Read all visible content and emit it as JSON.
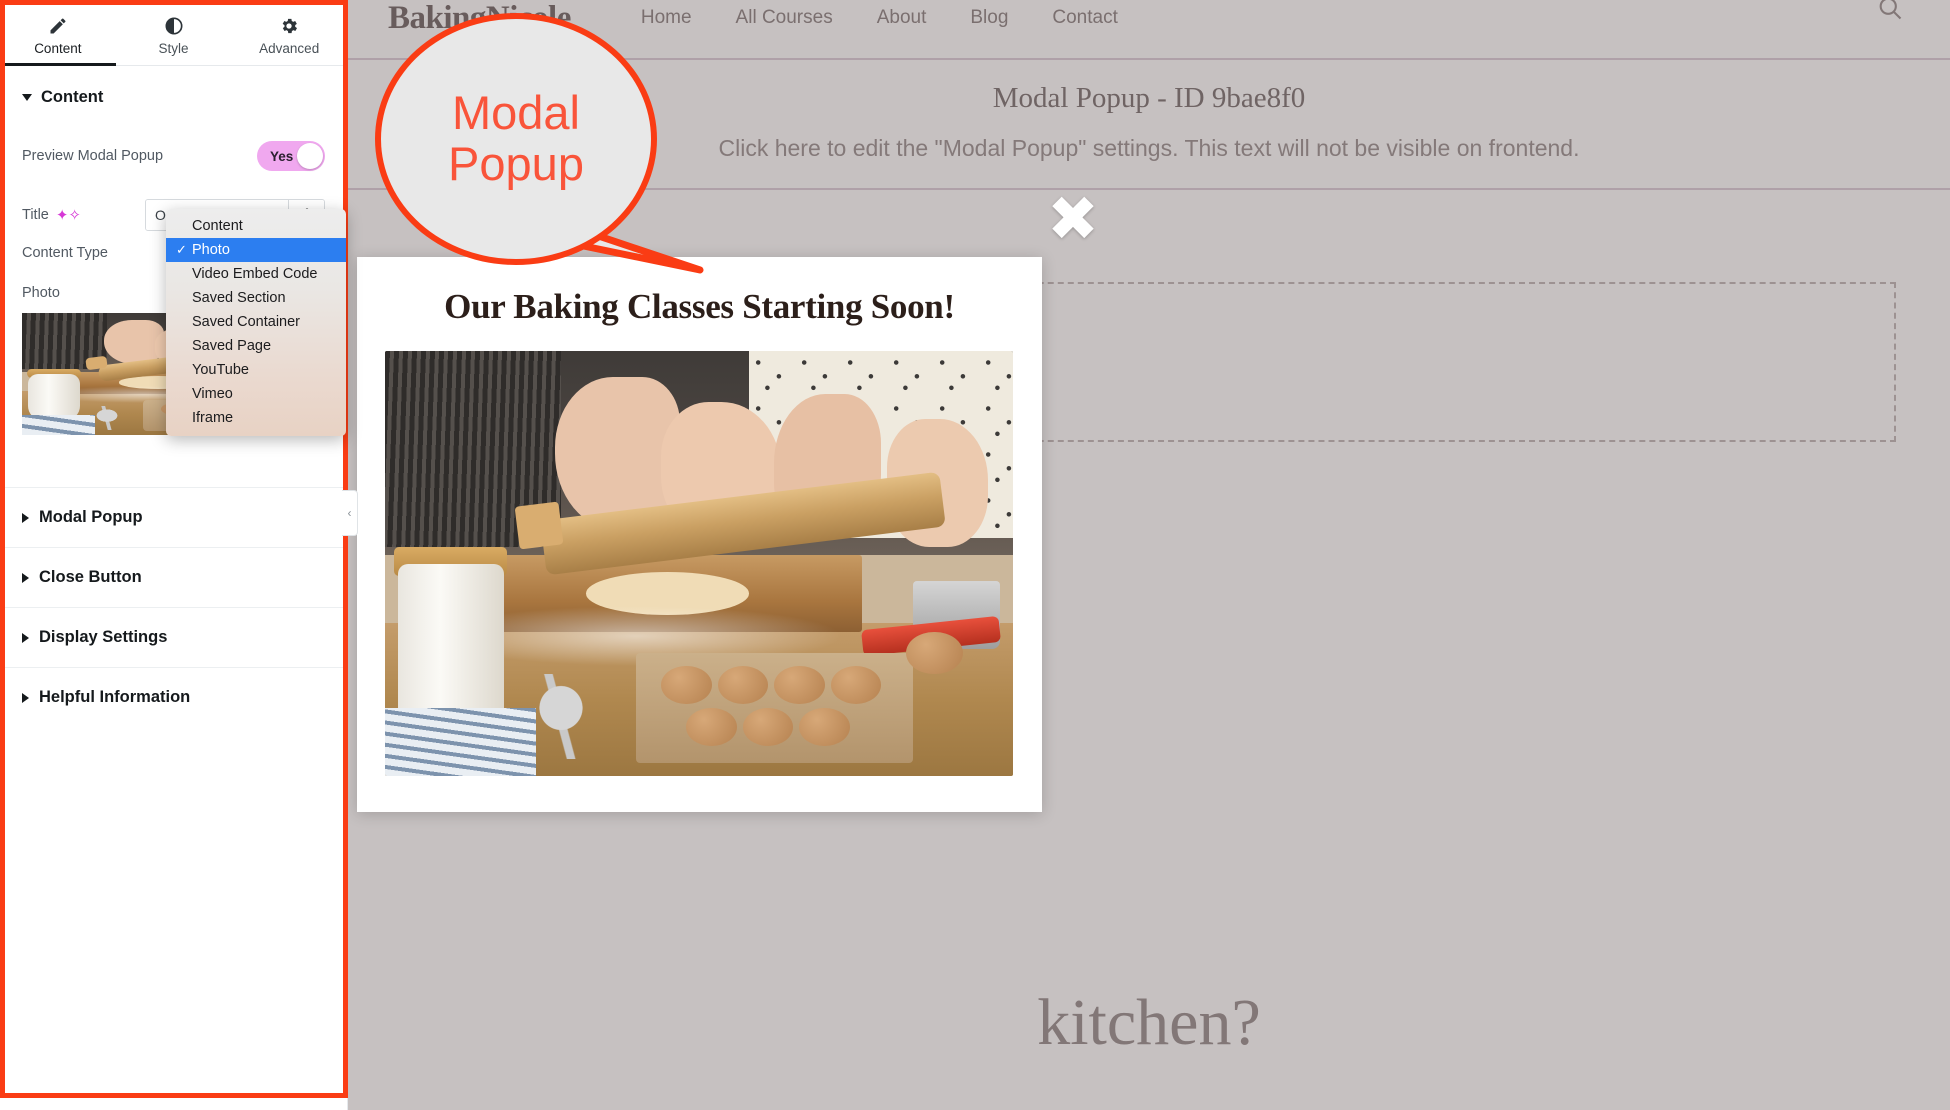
{
  "panel": {
    "tabs": [
      {
        "label": "Content",
        "icon": "pencil-icon",
        "active": true
      },
      {
        "label": "Style",
        "icon": "contrast-icon",
        "active": false
      },
      {
        "label": "Advanced",
        "icon": "gear-icon",
        "active": false
      }
    ],
    "content_section": {
      "title": "Content",
      "preview_toggle": {
        "label": "Preview Modal Popup",
        "value": "Yes"
      },
      "title_field": {
        "label": "Title",
        "value": "Our Baking Class",
        "ai_icon": "sparkle-icon",
        "addon_icon": "stack-icon"
      },
      "content_type": {
        "label": "Content Type",
        "value": "Photo"
      },
      "photo": {
        "label": "Photo"
      }
    },
    "accordions": [
      {
        "label": "Modal Popup"
      },
      {
        "label": "Close Button"
      },
      {
        "label": "Display Settings"
      },
      {
        "label": "Helpful Information"
      }
    ],
    "collapse_handle": "‹"
  },
  "dropdown": {
    "options": [
      {
        "label": "Content",
        "selected": false
      },
      {
        "label": "Photo",
        "selected": true
      },
      {
        "label": "Video Embed Code",
        "selected": false
      },
      {
        "label": "Saved Section",
        "selected": false
      },
      {
        "label": "Saved Container",
        "selected": false
      },
      {
        "label": "Saved Page",
        "selected": false
      },
      {
        "label": "YouTube",
        "selected": false
      },
      {
        "label": "Vimeo",
        "selected": false
      },
      {
        "label": "Iframe",
        "selected": false
      }
    ],
    "check_glyph": "✓"
  },
  "callout": {
    "line1": "Modal",
    "line2": "Popup",
    "color": "#f9543a"
  },
  "site": {
    "logo": "BakingNicole",
    "nav": [
      {
        "label": "Home"
      },
      {
        "label": "All Courses"
      },
      {
        "label": "About"
      },
      {
        "label": "Blog"
      },
      {
        "label": "Contact"
      }
    ],
    "search_icon": "search-icon",
    "editor_band": {
      "title": "Modal Popup - ID 9bae8f0",
      "subtitle": "Click here to edit the \"Modal Popup\" settings. This text will not be visible on frontend."
    },
    "hero_line_2": "kitchen?"
  },
  "modal": {
    "title": "Our Baking Classes Starting Soon!",
    "close_glyph": "✖",
    "photo_alt": "baking-photo"
  }
}
